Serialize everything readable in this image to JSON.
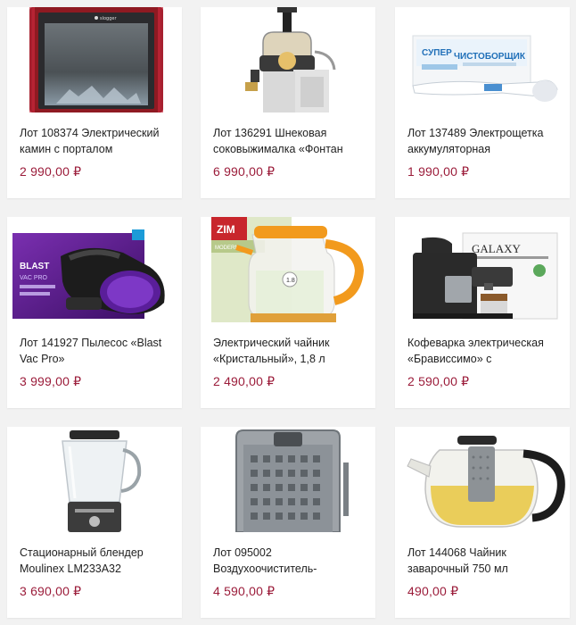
{
  "products": [
    {
      "title": "Лот 108374 Электрический камин с порталом",
      "price": "2 990,00 ₽",
      "image": "electric-fireplace",
      "brand": "slogger"
    },
    {
      "title": "Лот 136291 Шнековая соковыжималка «Фонтан",
      "price": "6 990,00 ₽",
      "image": "juicer"
    },
    {
      "title": "Лот 137489 Электрощетка аккумуляторная",
      "price": "1 990,00 ₽",
      "image": "electric-brush",
      "brand": "СУПЕР ЧИСТОБОРЩИК"
    },
    {
      "title": "Лот 141927 Пылесос «Blast Vac Pro»",
      "price": "3 999,00 ₽",
      "image": "handheld-vacuum",
      "brand": "BLAST VAC PRO"
    },
    {
      "title": "Электрический чайник «Кристальный», 1,8 л",
      "price": "2 490,00 ₽",
      "image": "glass-kettle",
      "brand": "ZIMBER"
    },
    {
      "title": "Кофеварка электрическая «Брависсимо» с",
      "price": "2 590,00 ₽",
      "image": "coffee-maker",
      "brand": "GALAXY"
    },
    {
      "title": "Стационарный блендер Moulinex LM233A32",
      "price": "3 690,00 ₽",
      "image": "blender"
    },
    {
      "title": "Лот 095002 Воздухоочиститель-",
      "price": "4 590,00 ₽",
      "image": "air-purifier"
    },
    {
      "title": "Лот 144068 Чайник заварочный 750 мл",
      "price": "490,00 ₽",
      "image": "teapot"
    }
  ],
  "colors": {
    "price": "#9b1c3a",
    "text": "#222222",
    "background": "#f2f2f2",
    "card": "#ffffff"
  }
}
